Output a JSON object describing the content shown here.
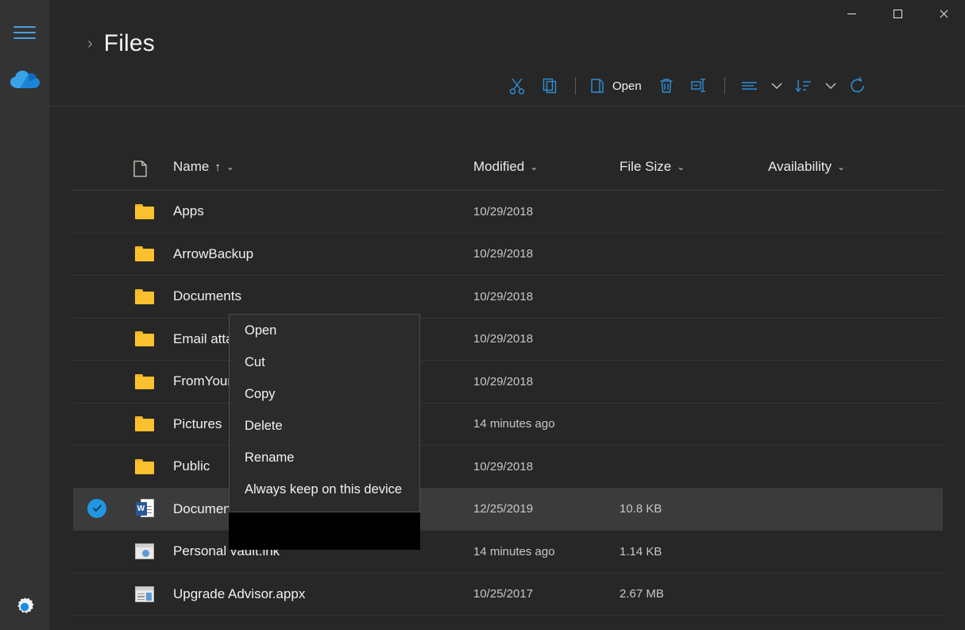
{
  "window": {
    "controls": [
      {
        "name": "minimize",
        "label": "—"
      },
      {
        "name": "maximize",
        "label": "□"
      },
      {
        "name": "close",
        "label": "✕"
      }
    ]
  },
  "sidebar": {
    "menu_icon": "hamburger-icon",
    "onedrive_icon": "onedrive-cloud-icon",
    "settings_icon": "gear-icon",
    "accent_color": "#2196e3"
  },
  "header": {
    "breadcrumb_chevron": "›",
    "title": "Files"
  },
  "toolbar": {
    "cut_label": "Cut",
    "copy_label": "Copy",
    "open_label": "Open",
    "delete_label": "Delete",
    "rename_label": "Rename",
    "view_label": "View",
    "sort_label": "Sort",
    "refresh_label": "Refresh",
    "icon_color": "#2f8fd8"
  },
  "columns": {
    "name": "Name",
    "name_sort_arrow": "↑",
    "modified": "Modified",
    "file_size": "File Size",
    "availability": "Availability",
    "chevron": "⌄"
  },
  "rows": [
    {
      "icon": "folder-icon",
      "name": "Apps",
      "modified": "10/29/2018",
      "size": "",
      "availability": "",
      "selected": false
    },
    {
      "icon": "folder-icon",
      "name": "ArrowBackup",
      "modified": "10/29/2018",
      "size": "",
      "availability": "",
      "selected": false
    },
    {
      "icon": "folder-icon",
      "name": "Documents",
      "modified": "10/29/2018",
      "size": "",
      "availability": "",
      "selected": false
    },
    {
      "icon": "folder-icon",
      "name": "Email atta",
      "modified": "10/29/2018",
      "size": "",
      "availability": "",
      "selected": false
    },
    {
      "icon": "folder-icon",
      "name": "FromYour",
      "modified": "10/29/2018",
      "size": "",
      "availability": "",
      "selected": false
    },
    {
      "icon": "folder-icon",
      "name": "Pictures",
      "modified": "14 minutes ago",
      "size": "",
      "availability": "",
      "selected": false
    },
    {
      "icon": "folder-icon",
      "name": "Public",
      "modified": "10/29/2018",
      "size": "",
      "availability": "",
      "selected": false
    },
    {
      "icon": "word-icon",
      "name": "Documen",
      "modified": "12/25/2019",
      "size": "10.8 KB",
      "availability": "",
      "selected": true
    },
    {
      "icon": "lnk-icon",
      "name": "Personal vault.lnk",
      "modified": "14 minutes ago",
      "size": "1.14 KB",
      "availability": "",
      "selected": false
    },
    {
      "icon": "appx-icon",
      "name": "Upgrade Advisor.appx",
      "modified": "10/25/2017",
      "size": "2.67 MB",
      "availability": "",
      "selected": false
    }
  ],
  "context_menu": {
    "items": [
      {
        "label": "Open"
      },
      {
        "label": "Cut"
      },
      {
        "label": "Copy"
      },
      {
        "label": "Delete"
      },
      {
        "label": "Rename"
      },
      {
        "label": "Always keep on this device"
      }
    ]
  }
}
